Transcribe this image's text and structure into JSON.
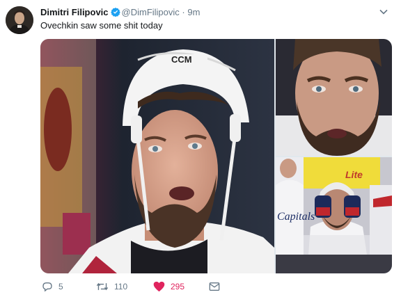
{
  "tweet": {
    "author_name": "Dimitri Filipovic",
    "handle": "@DimFilipovic",
    "separator": "·",
    "time": "9m",
    "text": "Ovechkin saw some shit today"
  },
  "actions": {
    "replies": "5",
    "retweets": "110",
    "likes": "295"
  },
  "colors": {
    "verified": "#1da1f2",
    "like": "#e0245e",
    "muted": "#657786"
  },
  "icons": [
    "verified-badge-icon",
    "chevron-down-icon",
    "reply-icon",
    "retweet-icon",
    "heart-icon",
    "direct-message-icon"
  ]
}
